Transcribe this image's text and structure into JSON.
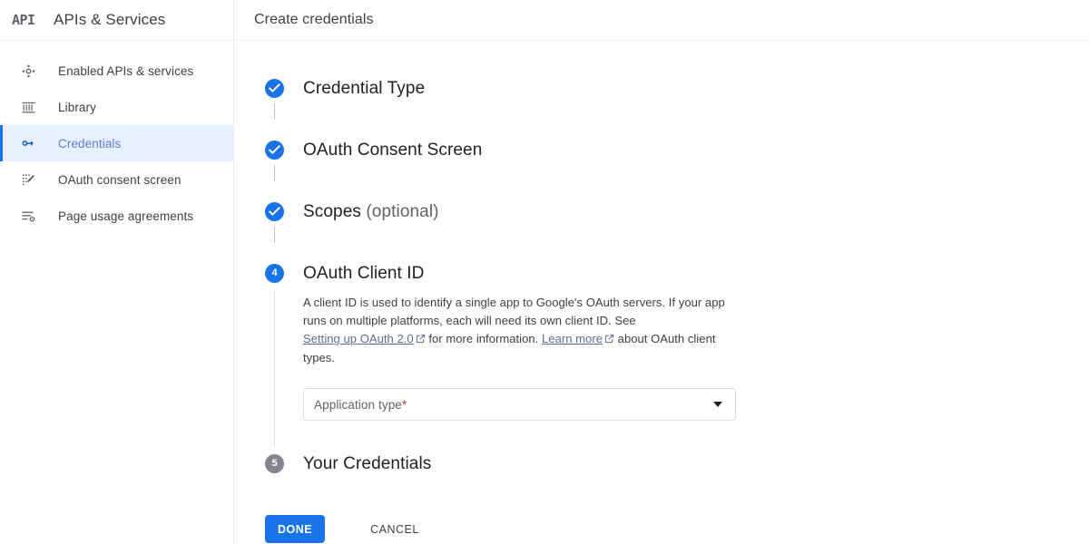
{
  "brand": {
    "logo_text": "API",
    "title": "APIs & Services"
  },
  "sidebar": {
    "items": [
      {
        "label": "Enabled APIs & services",
        "icon": "api-hub-icon",
        "active": false
      },
      {
        "label": "Library",
        "icon": "library-icon",
        "active": false
      },
      {
        "label": "Credentials",
        "icon": "key-icon",
        "active": true
      },
      {
        "label": "OAuth consent screen",
        "icon": "consent-screen-icon",
        "active": false
      },
      {
        "label": "Page usage agreements",
        "icon": "agreements-icon",
        "active": false
      }
    ]
  },
  "header": {
    "title": "Create credentials"
  },
  "wizard": {
    "steps": [
      {
        "number": "1",
        "state": "done",
        "title": "Credential Type",
        "optional_suffix": ""
      },
      {
        "number": "2",
        "state": "done",
        "title": "OAuth Consent Screen",
        "optional_suffix": ""
      },
      {
        "number": "3",
        "state": "done",
        "title": "Scopes",
        "optional_suffix": "(optional)"
      },
      {
        "number": "4",
        "state": "current",
        "title": "OAuth Client ID",
        "optional_suffix": ""
      },
      {
        "number": "5",
        "state": "pending",
        "title": "Your Credentials",
        "optional_suffix": ""
      }
    ],
    "client_id_description": {
      "text_1": "A client ID is used to identify a single app to Google's OAuth servers. If your app runs on multiple platforms, each will need its own client ID. See ",
      "link_1": "Setting up OAuth 2.0",
      "text_2": " for more information. ",
      "link_2": "Learn more",
      "text_3": " about OAuth client types."
    },
    "application_type_field": {
      "label": "Application type",
      "required_marker": "*",
      "value": ""
    }
  },
  "actions": {
    "done_label": "DONE",
    "cancel_label": "CANCEL"
  },
  "colors": {
    "accent_blue": "#1a73e8",
    "active_nav_bg": "#e8f0fe",
    "pending_gray": "#80868b",
    "required_red": "#d93025",
    "link_blue": "#5a6b8c"
  }
}
